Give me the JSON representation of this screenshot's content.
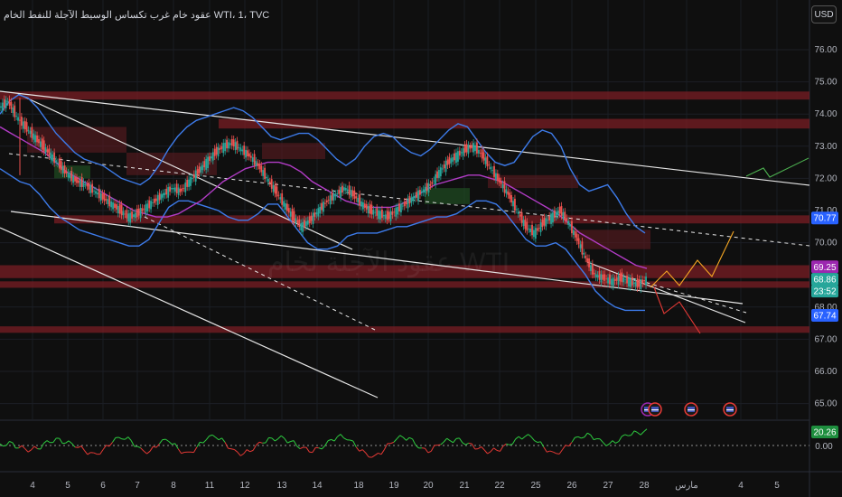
{
  "header": {
    "title": "عقود خام غرب تكساس الوسيط الآجلة للنفط الخام WTI، 1، TVC",
    "currency_button": "USD"
  },
  "watermark": "عقود الآجلة لخام WTI",
  "colors": {
    "bg": "#0f0f0f",
    "zone": "#7a1e24",
    "bollinger": "#3d7bea",
    "ma": "#b23cc6",
    "price": "#d9d9d9",
    "up": "#26a69a",
    "down": "#ef5350",
    "osc_up": "#2ecc40",
    "osc_down": "#e53935",
    "projection_orange": "#f5a623",
    "projection_red": "#e53935",
    "projection_green": "#4caf50"
  },
  "chart_data": [
    {
      "type": "line",
      "y_axis": {
        "ticks": [
          "76.00",
          "75.00",
          "74.00",
          "73.00",
          "72.00",
          "71.00",
          "70.00",
          "68.00",
          "67.00",
          "66.00",
          "65.00"
        ],
        "ylim": [
          64.6,
          76.4
        ]
      },
      "x_axis": {
        "ticks": [
          "4",
          "5",
          "6",
          "7",
          "8",
          "11",
          "12",
          "13",
          "14",
          "18",
          "19",
          "20",
          "21",
          "22",
          "25",
          "26",
          "27",
          "28",
          "مارس",
          "4",
          "5"
        ]
      },
      "price": [
        74.2,
        74.4,
        73.9,
        73.6,
        73.3,
        73.0,
        72.7,
        72.4,
        72.1,
        71.9,
        71.8,
        71.6,
        71.4,
        71.2,
        71.0,
        70.8,
        70.9,
        71.1,
        71.3,
        71.5,
        71.7,
        71.6,
        71.9,
        72.2,
        72.5,
        72.8,
        73.0,
        73.1,
        72.9,
        72.7,
        72.4,
        72.0,
        71.6,
        71.2,
        70.8,
        70.5,
        70.7,
        71.0,
        71.3,
        71.5,
        71.7,
        71.5,
        71.2,
        71.0,
        70.9,
        70.8,
        71.0,
        71.2,
        71.4,
        71.6,
        71.8,
        72.2,
        72.5,
        72.7,
        72.9,
        73.0,
        72.7,
        72.3,
        71.9,
        71.5,
        71.0,
        70.5,
        70.3,
        70.6,
        70.8,
        71.0,
        70.6,
        70.1,
        69.5,
        69.0,
        68.9,
        68.8,
        68.9,
        68.8,
        68.7,
        68.86
      ],
      "bollinger_upper": [
        74.0,
        74.4,
        74.6,
        74.5,
        74.2,
        73.8,
        73.4,
        73.1,
        72.8,
        72.6,
        72.5,
        72.4,
        72.2,
        72.0,
        71.9,
        71.8,
        72.0,
        72.4,
        72.9,
        73.3,
        73.6,
        73.8,
        73.9,
        74.0,
        74.1,
        74.2,
        74.1,
        73.9,
        73.6,
        73.3,
        73.2,
        73.3,
        73.4,
        73.4,
        73.2,
        72.9,
        72.6,
        72.4,
        72.6,
        73.0,
        73.3,
        73.4,
        73.3,
        73.0,
        72.8,
        72.7,
        72.9,
        73.2,
        73.5,
        73.7,
        73.6,
        73.2,
        72.8,
        72.5,
        72.4,
        72.5,
        72.9,
        73.3,
        73.5,
        73.4,
        73.0,
        72.3,
        71.8,
        71.6,
        71.7,
        71.8,
        71.4,
        70.9,
        70.5,
        70.3
      ],
      "bollinger_lower": [
        72.3,
        72.1,
        71.9,
        71.8,
        71.5,
        71.1,
        70.8,
        70.6,
        70.4,
        70.3,
        70.2,
        70.1,
        70.0,
        69.9,
        69.9,
        70.1,
        70.6,
        71.1,
        71.3,
        71.3,
        71.2,
        71.1,
        71.0,
        70.8,
        70.7,
        70.7,
        70.9,
        71.2,
        71.2,
        70.8,
        70.4,
        70.0,
        69.8,
        69.8,
        69.9,
        70.2,
        70.3,
        70.3,
        70.3,
        70.4,
        70.5,
        70.5,
        70.6,
        70.7,
        70.8,
        70.8,
        70.9,
        71.1,
        71.3,
        71.3,
        71.2,
        70.9,
        70.5,
        70.1,
        69.9,
        69.9,
        70.0,
        69.8,
        69.4,
        69.0,
        68.5,
        68.2,
        68.0,
        67.9,
        67.9,
        67.9
      ],
      "moving_average": [
        73.6,
        73.4,
        73.2,
        73.0,
        72.8,
        72.5,
        72.2,
        72.0,
        71.8,
        71.6,
        71.4,
        71.2,
        71.0,
        70.9,
        70.8,
        70.8,
        70.9,
        71.1,
        71.3,
        71.6,
        71.9,
        72.1,
        72.3,
        72.4,
        72.5,
        72.5,
        72.4,
        72.2,
        71.9,
        71.7,
        71.5,
        71.3,
        71.2,
        71.1,
        71.1,
        71.1,
        71.2,
        71.4,
        71.6,
        71.8,
        71.9,
        72.0,
        72.1,
        72.1,
        72.0,
        71.9,
        71.7,
        71.5,
        71.3,
        71.1,
        70.9,
        70.6,
        70.3,
        70.1,
        69.9,
        69.7,
        69.5,
        69.3,
        69.2
      ],
      "resistance_zones": [
        [
          74.45,
          74.7
        ],
        [
          73.55,
          73.85
        ],
        [
          70.6,
          70.85
        ],
        [
          68.9,
          69.3
        ],
        [
          68.6,
          68.8
        ],
        [
          67.2,
          67.4
        ]
      ],
      "price_labels": [
        {
          "value": "70.77",
          "color": "#2962ff",
          "text_color": "#ffffff"
        },
        {
          "value": "69.25",
          "color": "#9c27b0",
          "text_color": "#ffffff"
        },
        {
          "value": "68.86",
          "color": "#26a69a",
          "text_color": "#ffffff"
        },
        {
          "value": "23:52",
          "color": "#26a69a",
          "text_color": "#ffffff"
        },
        {
          "value": "67.74",
          "color": "#2962ff",
          "text_color": "#ffffff"
        }
      ]
    },
    {
      "type": "line",
      "y_axis": {
        "ticks": [
          "0.00"
        ]
      },
      "series": [
        {
          "values": [
            2,
            5,
            -3,
            -8,
            -4,
            6,
            9,
            3,
            -2,
            -6,
            -9,
            -5,
            4,
            8,
            6,
            -3,
            -7,
            2,
            5,
            -4,
            -8,
            -2,
            7,
            10,
            4,
            -5,
            -10,
            -6,
            3,
            9,
            12,
            5,
            -4,
            -8,
            -3,
            6,
            11,
            7,
            -2,
            -9,
            -12,
            -5,
            4,
            10,
            8,
            -3,
            -7,
            1,
            6,
            9,
            3,
            -4,
            -10,
            -6,
            2,
            8,
            11,
            6,
            -2,
            -8,
            -5,
            4,
            9,
            13,
            8,
            2,
            5,
            12,
            16,
            20.26
          ]
        }
      ],
      "label": {
        "value": "20.26",
        "color": "#1e8e3e",
        "text_color": "#ffffff"
      }
    }
  ]
}
